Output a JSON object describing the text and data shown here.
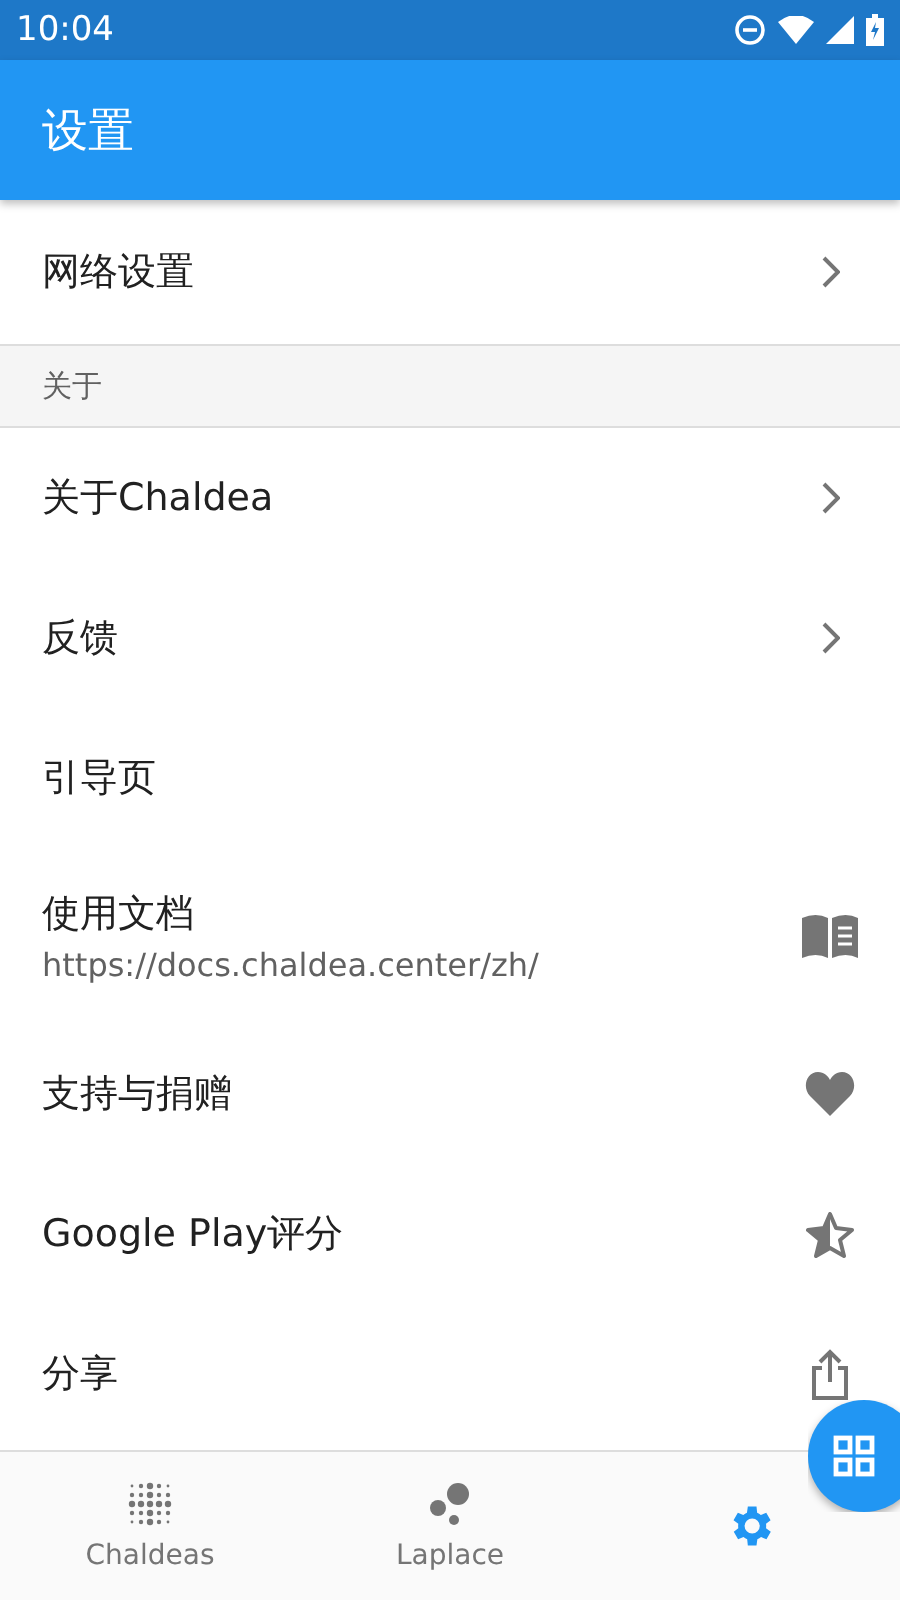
{
  "status_bar": {
    "time": "10:04"
  },
  "toolbar": {
    "title": "设置"
  },
  "sections": [
    {
      "items": [
        {
          "title": "网络设置",
          "kind": "chevron"
        }
      ]
    },
    {
      "header": "关于",
      "items": [
        {
          "title": "关于Chaldea",
          "kind": "chevron"
        },
        {
          "title": "反馈",
          "kind": "chevron"
        },
        {
          "title": "引导页",
          "kind": "plain"
        },
        {
          "title": "使用文档",
          "subtitle": "https://docs.chaldea.center/zh/",
          "kind": "book"
        },
        {
          "title": "支持与捐赠",
          "kind": "heart"
        },
        {
          "title": "Google Play评分",
          "kind": "star"
        },
        {
          "title": "分享",
          "kind": "share"
        }
      ]
    }
  ],
  "bottom_nav": [
    {
      "label": "Chaldeas",
      "selected": false
    },
    {
      "label": "Laplace",
      "selected": false
    },
    {
      "selected": true
    }
  ]
}
